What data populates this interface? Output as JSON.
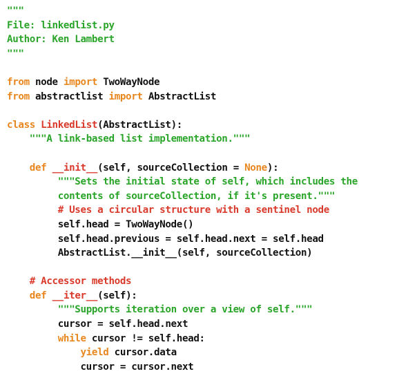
{
  "file": {
    "name": "linkedlist.py",
    "language": "python"
  },
  "colors": {
    "string": "#2aa52a",
    "keyword": "#e8871f",
    "class_name": "#d93a2b",
    "comment": "#d93a2b",
    "text": "#111111",
    "background": "#ffffff"
  },
  "lines": [
    [
      {
        "t": "\"\"\"",
        "k": "str"
      }
    ],
    [
      {
        "t": "File: linkedlist.py",
        "k": "str"
      }
    ],
    [
      {
        "t": "Author: Ken Lambert",
        "k": "str"
      }
    ],
    [
      {
        "t": "\"\"\"",
        "k": "str"
      }
    ],
    [],
    [
      {
        "t": "from",
        "k": "kw"
      },
      {
        "t": " node ",
        "k": "plain"
      },
      {
        "t": "import",
        "k": "kw"
      },
      {
        "t": " TwoWayNode",
        "k": "plain"
      }
    ],
    [
      {
        "t": "from",
        "k": "kw"
      },
      {
        "t": " abstractlist ",
        "k": "plain"
      },
      {
        "t": "import",
        "k": "kw"
      },
      {
        "t": " AbstractList",
        "k": "plain"
      }
    ],
    [],
    [
      {
        "t": "class",
        "k": "kw"
      },
      {
        "t": " ",
        "k": "plain"
      },
      {
        "t": "LinkedList",
        "k": "cls"
      },
      {
        "t": "(AbstractList):",
        "k": "plain"
      }
    ],
    [
      {
        "t": "    ",
        "k": "plain"
      },
      {
        "t": "\"\"\"A link-based list implementation.\"\"\"",
        "k": "str"
      }
    ],
    [],
    [
      {
        "t": "    ",
        "k": "plain"
      },
      {
        "t": "def",
        "k": "kw"
      },
      {
        "t": " ",
        "k": "plain"
      },
      {
        "t": "__init__",
        "k": "cls"
      },
      {
        "t": "(self, sourceCollection = ",
        "k": "plain"
      },
      {
        "t": "None",
        "k": "kw"
      },
      {
        "t": "):",
        "k": "plain"
      }
    ],
    [
      {
        "t": "         ",
        "k": "plain"
      },
      {
        "t": "\"\"\"Sets the initial state of self, which includes the",
        "k": "str"
      }
    ],
    [
      {
        "t": "         ",
        "k": "plain"
      },
      {
        "t": "contents of sourceCollection, if it's present.\"\"\"",
        "k": "str"
      }
    ],
    [
      {
        "t": "         ",
        "k": "plain"
      },
      {
        "t": "# Uses a circular structure with a sentinel node",
        "k": "com"
      }
    ],
    [
      {
        "t": "         self.head = TwoWayNode()",
        "k": "plain"
      }
    ],
    [
      {
        "t": "         self.head.previous = self.head.next = self.head",
        "k": "plain"
      }
    ],
    [
      {
        "t": "         AbstractList.__init__(self, sourceCollection)",
        "k": "plain"
      }
    ],
    [],
    [
      {
        "t": "    ",
        "k": "plain"
      },
      {
        "t": "# Accessor methods",
        "k": "com"
      }
    ],
    [
      {
        "t": "    ",
        "k": "plain"
      },
      {
        "t": "def",
        "k": "kw"
      },
      {
        "t": " ",
        "k": "plain"
      },
      {
        "t": "__iter__",
        "k": "cls"
      },
      {
        "t": "(self):",
        "k": "plain"
      }
    ],
    [
      {
        "t": "         ",
        "k": "plain"
      },
      {
        "t": "\"\"\"Supports iteration over a view of self.\"\"\"",
        "k": "str"
      }
    ],
    [
      {
        "t": "         cursor = self.head.next",
        "k": "plain"
      }
    ],
    [
      {
        "t": "         ",
        "k": "plain"
      },
      {
        "t": "while",
        "k": "kw"
      },
      {
        "t": " cursor != self.head:",
        "k": "plain"
      }
    ],
    [
      {
        "t": "             ",
        "k": "plain"
      },
      {
        "t": "yield",
        "k": "kw"
      },
      {
        "t": " cursor.data",
        "k": "plain"
      }
    ],
    [
      {
        "t": "             cursor = cursor.next",
        "k": "plain"
      }
    ]
  ]
}
